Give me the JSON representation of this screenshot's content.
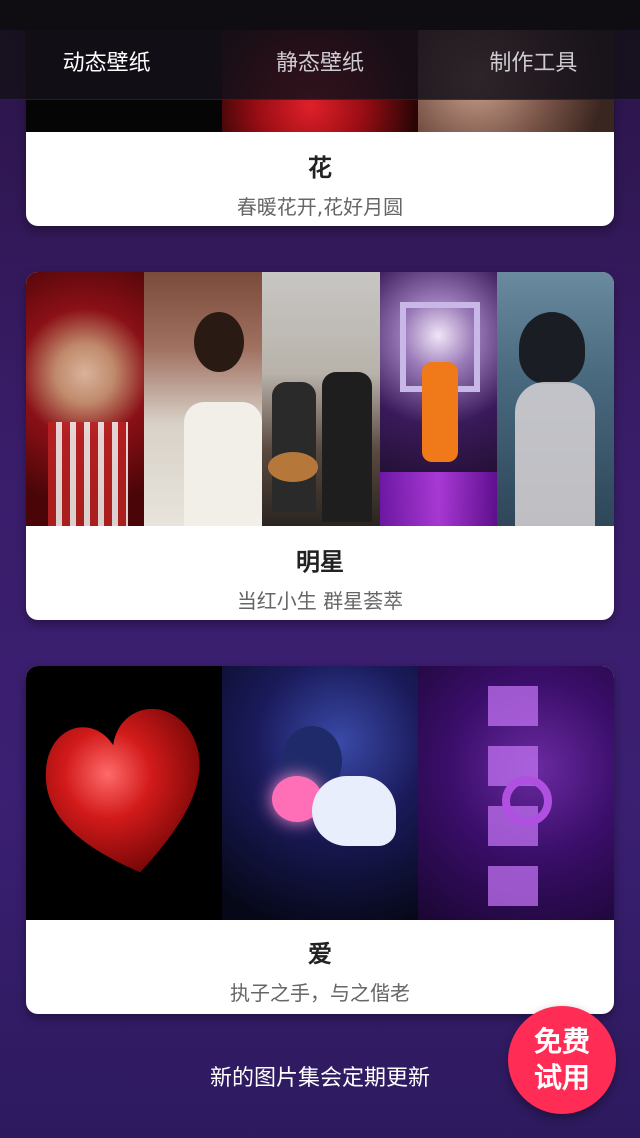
{
  "tabs": [
    {
      "label": "动态壁纸",
      "active": true
    },
    {
      "label": "静态壁纸",
      "active": false
    },
    {
      "label": "制作工具",
      "active": false
    }
  ],
  "cards": [
    {
      "title": "花",
      "subtitle": "春暖花开,花好月圆",
      "thumbnails": [
        "black-flower",
        "red-rose",
        "pink-blossom"
      ]
    },
    {
      "title": "明星",
      "subtitle": "当红小生 群星荟萃",
      "thumbnails": [
        "star-red-roses",
        "star-white-scarf",
        "star-guitar-duo",
        "star-stage-dance",
        "star-blue-portrait"
      ]
    },
    {
      "title": "爱",
      "subtitle": "执子之手，与之偕老",
      "thumbnails": [
        "red-heart-love",
        "anime-girl-heart",
        "purple-love-text"
      ]
    }
  ],
  "footer_note": "新的图片集会定期更新",
  "fab": {
    "line1": "免费",
    "line2": "试用"
  },
  "colors": {
    "accent": "#ff2d55",
    "background": "#3a1d6a",
    "card": "#ffffff"
  }
}
